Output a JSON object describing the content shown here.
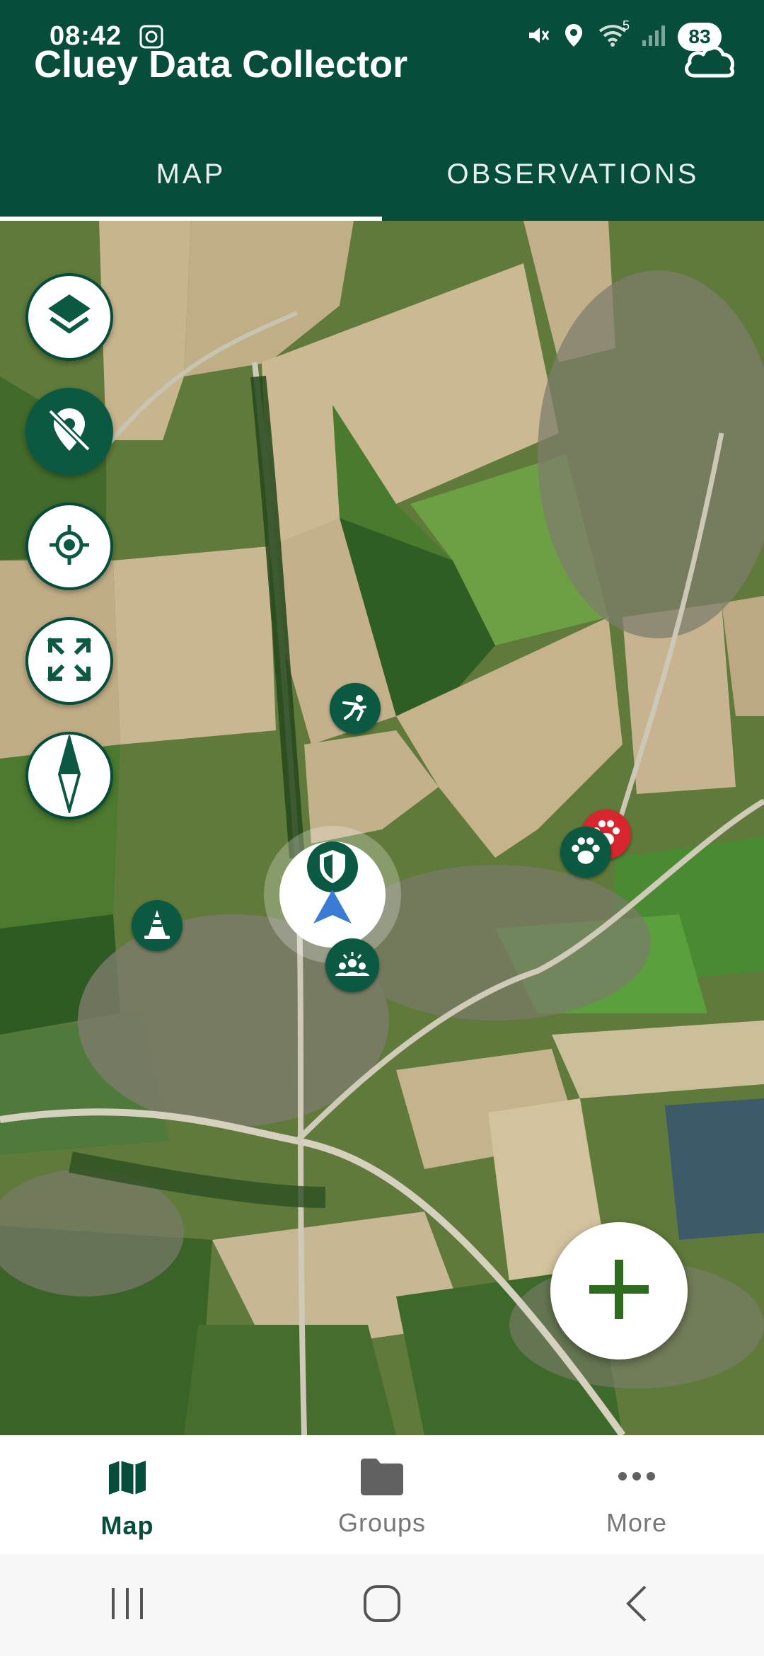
{
  "status_bar": {
    "time": "08:42",
    "battery": "83",
    "signal_label": "5"
  },
  "header": {
    "title": "Cluey Data Collector",
    "cloud_icon": "cloud-icon"
  },
  "tabs": [
    {
      "label": "MAP",
      "active": true
    },
    {
      "label": "OBSERVATIONS",
      "active": false
    }
  ],
  "map": {
    "controls": [
      "layers-icon",
      "location-off-icon",
      "my-location-icon",
      "fullscreen-icon",
      "compass-icon"
    ],
    "markers": [
      "hunter-icon",
      "traffic-cone-icon",
      "paw-icon",
      "paw-red-icon",
      "group-icon",
      "shield-icon"
    ],
    "fab_icon": "plus-icon"
  },
  "bottom_nav": {
    "items": [
      {
        "label": "Map",
        "icon": "map-icon",
        "active": true
      },
      {
        "label": "Groups",
        "icon": "folder-icon",
        "active": false
      },
      {
        "label": "More",
        "icon": "more-dots-icon",
        "active": false
      }
    ]
  },
  "colors": {
    "primary": "#064d3b",
    "accent_green": "#2e6b1f",
    "paw_red": "#d7262d"
  }
}
